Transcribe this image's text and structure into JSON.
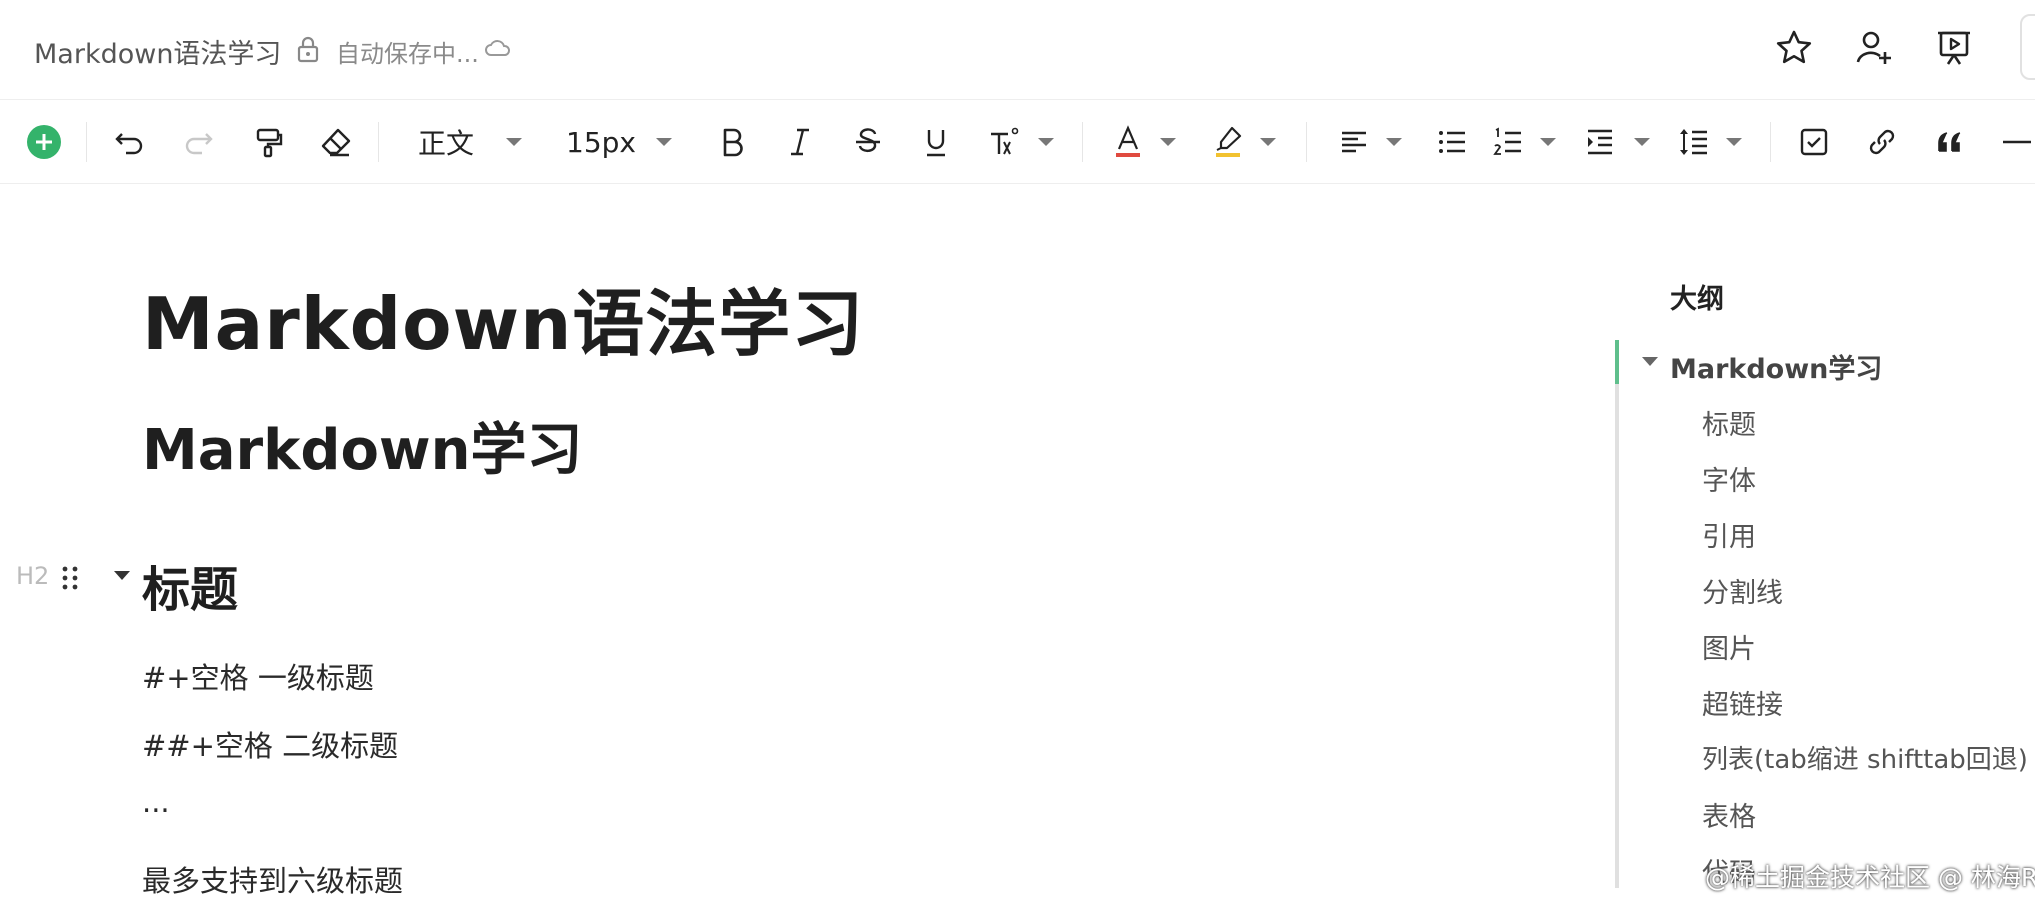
{
  "header": {
    "title": "Markdown语法学习",
    "save_status": "自动保存中..."
  },
  "toolbar": {
    "text_style": "正文",
    "font_size": "15px"
  },
  "colors": {
    "accent_green": "#34b36b",
    "font_color_underline": "#e04a3f",
    "highlight_underline": "#f2c230",
    "outline_active": "#5fbf8c"
  },
  "editor": {
    "h1": "Markdown语法学习",
    "h1_sub": "Markdown学习",
    "h2_tag": "H2",
    "h2": "标题",
    "paragraphs": [
      "#+空格 一级标题",
      "##+空格 二级标题",
      "...",
      "最多支持到六级标题"
    ]
  },
  "outline": {
    "title": "大纲",
    "root": "Markdown学习",
    "items": [
      "标题",
      "字体",
      "引用",
      "分割线",
      "图片",
      "超链接",
      "列表(tab缩进 shifttab回退)",
      "表格",
      "代码"
    ]
  },
  "watermark": "@稀土掘金技术社区 @ 林海Reese"
}
